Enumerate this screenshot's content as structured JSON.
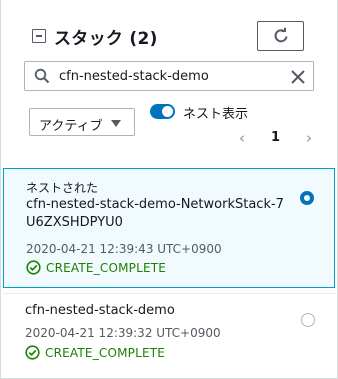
{
  "header": {
    "title": "スタック (2)"
  },
  "search": {
    "value": "cfn-nested-stack-demo"
  },
  "filters": {
    "status_dropdown_label": "アクティブ",
    "nested_toggle_label": "ネスト表示",
    "nested_toggle_on": true
  },
  "pagination": {
    "prev_icon": "‹",
    "current_page": "1",
    "next_icon": "›"
  },
  "stacks": [
    {
      "nested_label": "ネストされた",
      "name": "cfn-nested-stack-demo-NetworkStack-7U6ZXSHDPYU0",
      "timestamp": "2020-04-21 12:39:43 UTC+0900",
      "status": "CREATE_COMPLETE",
      "selected": true
    },
    {
      "name": "cfn-nested-stack-demo",
      "timestamp": "2020-04-21 12:39:32 UTC+0900",
      "status": "CREATE_COMPLETE",
      "selected": false
    }
  ],
  "colors": {
    "accent": "#0073bb",
    "selected_bg": "#f1faff",
    "selected_border": "#00a1c9",
    "success": "#1d8102"
  },
  "icons": [
    "collapse-icon",
    "refresh-icon",
    "search-icon",
    "clear-icon",
    "caret-down-icon",
    "check-circle-icon"
  ]
}
